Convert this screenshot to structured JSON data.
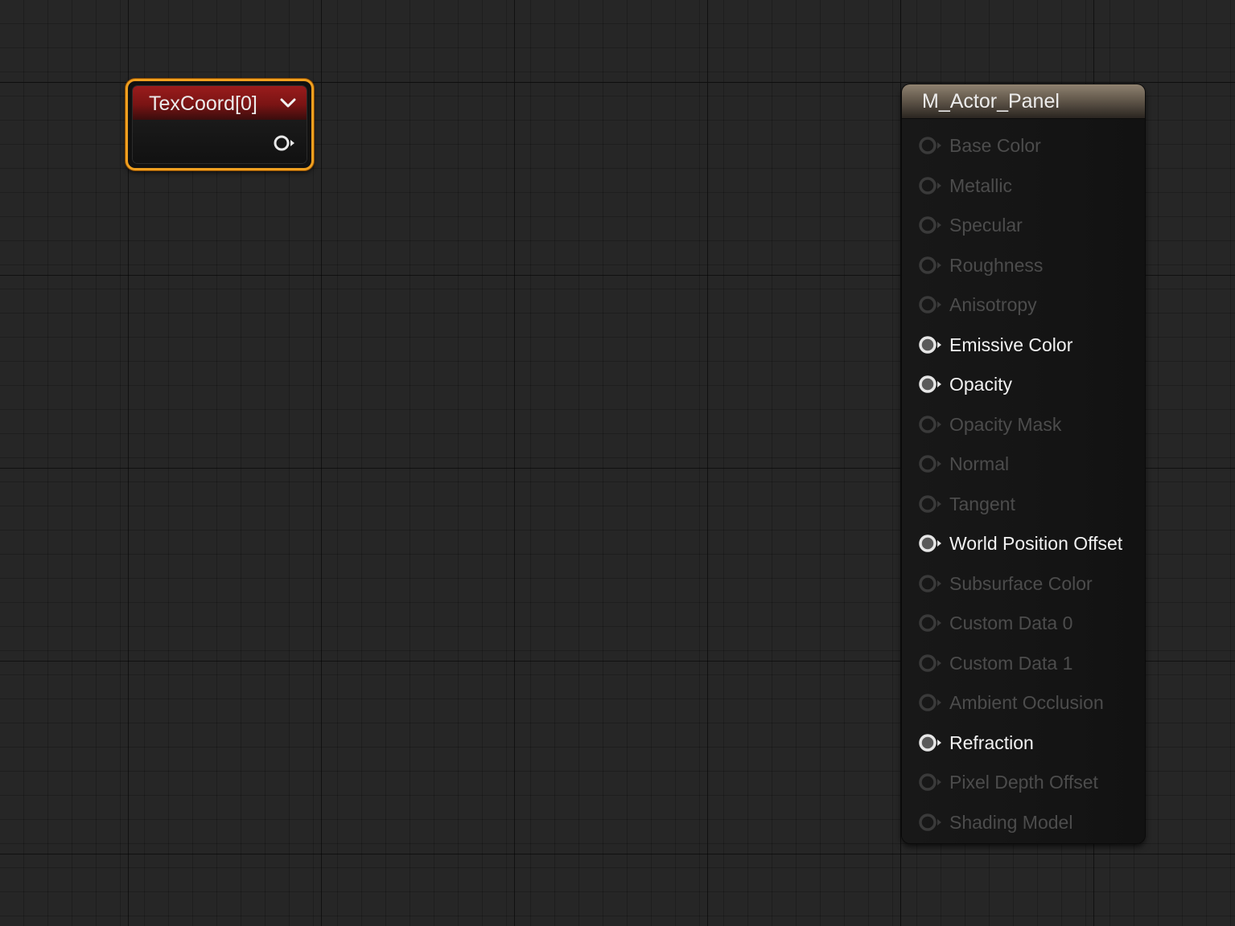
{
  "texcoord_node": {
    "title": "TexCoord[0]",
    "header_color": "#8e1a1a",
    "selection_color": "#f0a020"
  },
  "material_node": {
    "title": "M_Actor_Panel",
    "header_color": "#7d7162",
    "pins": [
      {
        "label": "Base Color",
        "active": false
      },
      {
        "label": "Metallic",
        "active": false
      },
      {
        "label": "Specular",
        "active": false
      },
      {
        "label": "Roughness",
        "active": false
      },
      {
        "label": "Anisotropy",
        "active": false
      },
      {
        "label": "Emissive Color",
        "active": true
      },
      {
        "label": "Opacity",
        "active": true
      },
      {
        "label": "Opacity Mask",
        "active": false
      },
      {
        "label": "Normal",
        "active": false
      },
      {
        "label": "Tangent",
        "active": false
      },
      {
        "label": "World Position Offset",
        "active": true
      },
      {
        "label": "Subsurface Color",
        "active": false
      },
      {
        "label": "Custom Data 0",
        "active": false
      },
      {
        "label": "Custom Data 1",
        "active": false
      },
      {
        "label": "Ambient Occlusion",
        "active": false
      },
      {
        "label": "Refraction",
        "active": true
      },
      {
        "label": "Pixel Depth Offset",
        "active": false
      },
      {
        "label": "Shading Model",
        "active": false
      }
    ]
  }
}
